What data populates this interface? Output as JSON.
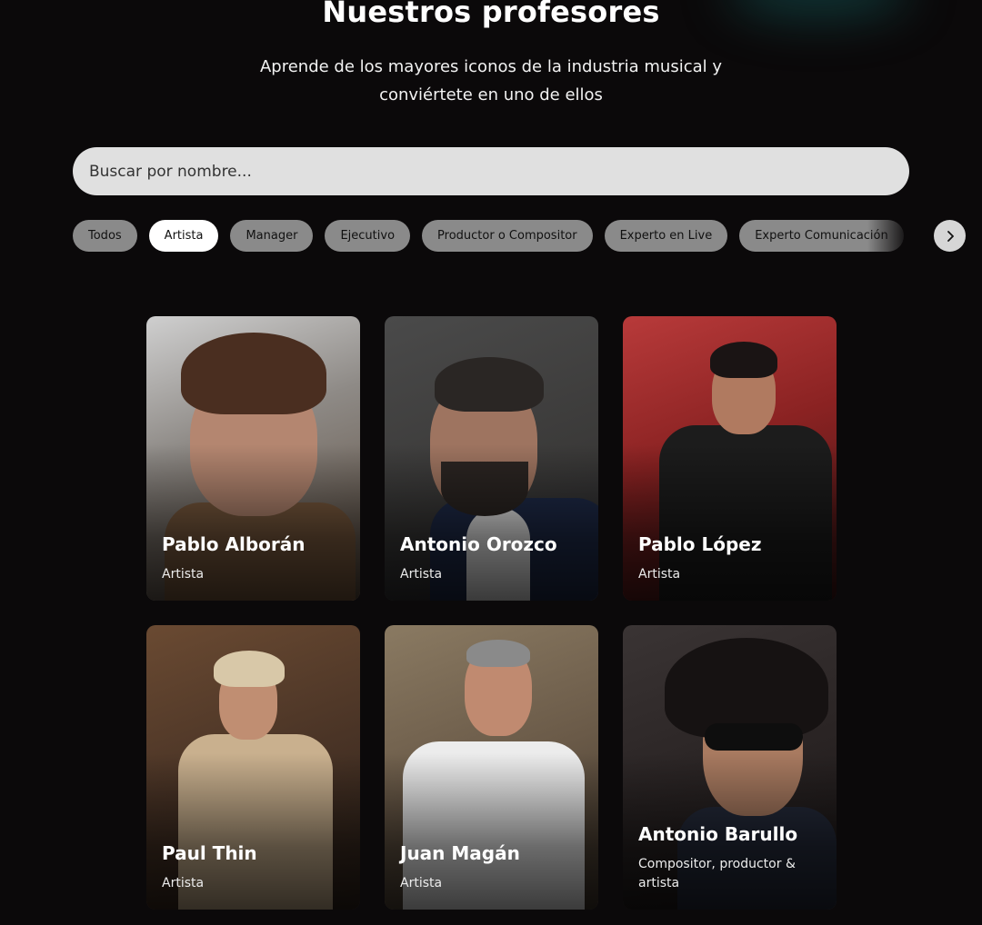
{
  "header": {
    "title": "Nuestros profesores",
    "subtitle": "Aprende de los mayores iconos de la industria musical y conviértete en uno de ellos"
  },
  "search": {
    "placeholder": "Buscar por nombre...",
    "value": ""
  },
  "filters": {
    "active": "Artista",
    "items": [
      {
        "label": "Todos"
      },
      {
        "label": "Artista"
      },
      {
        "label": "Manager"
      },
      {
        "label": "Ejecutivo"
      },
      {
        "label": "Productor o Compositor"
      },
      {
        "label": "Experto en Live"
      },
      {
        "label": "Experto Comunicación"
      }
    ],
    "next_icon": "chevron-right-icon"
  },
  "teachers": [
    {
      "name": "Pablo Alborán",
      "role": "Artista"
    },
    {
      "name": "Antonio Orozco",
      "role": "Artista"
    },
    {
      "name": "Pablo López",
      "role": "Artista"
    },
    {
      "name": "Paul Thin",
      "role": "Artista"
    },
    {
      "name": "Juan Magán",
      "role": "Artista"
    },
    {
      "name": "Antonio Barullo",
      "role": "Compositor, productor & artista"
    }
  ],
  "colors": {
    "background": "#0b090a",
    "search_bg": "#e0e0e0",
    "chip_bg": "#8a8a8a",
    "chip_active_bg": "#ffffff"
  }
}
